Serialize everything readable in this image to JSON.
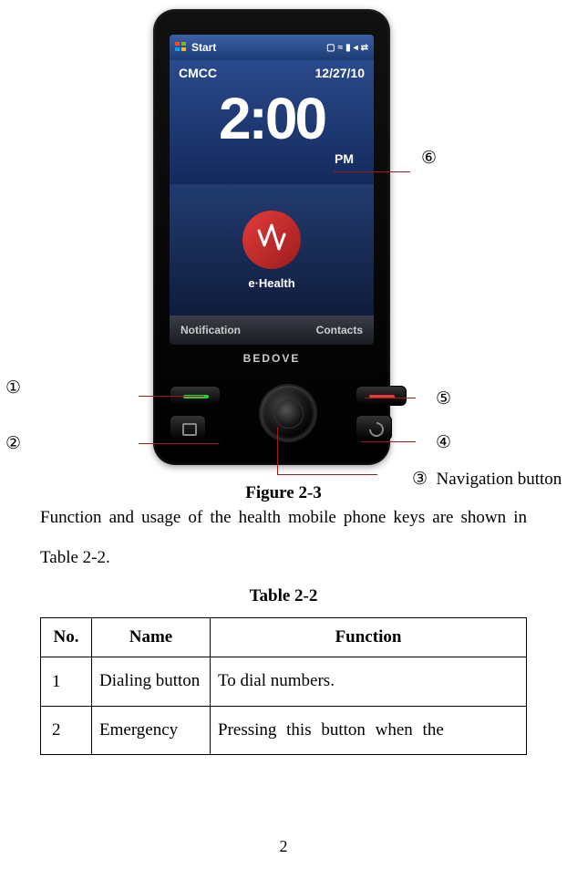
{
  "phone": {
    "taskbar": {
      "start": "Start",
      "icons": [
        "sim",
        "sync",
        "speaker",
        "signal",
        "arrows"
      ]
    },
    "carrier": "CMCC",
    "date": "12/27/10",
    "clock": "2:00",
    "ampm": "PM",
    "appname": "e·Health",
    "softkeys": {
      "left": "Notification",
      "right": "Contacts"
    },
    "brand": "BEDOVE"
  },
  "callouts": {
    "c1": "①",
    "c2": "②",
    "c3": "③",
    "c3_label": "Navigation button",
    "c4": "④",
    "c5": "⑤",
    "c6": "⑥"
  },
  "figure_caption": "Figure 2-3",
  "body_text": "Function and usage of the health mobile phone keys are shown in Table 2-2.",
  "table_caption": "Table 2-2",
  "table": {
    "headers": {
      "no": "No.",
      "name": "Name",
      "fn": "Function"
    },
    "rows": [
      {
        "no": "1",
        "name": "Dialing button",
        "fn": "To dial numbers."
      },
      {
        "no": "2",
        "name": "Emergency",
        "fn": "Pressing this button when the"
      }
    ]
  },
  "page_number": "2"
}
